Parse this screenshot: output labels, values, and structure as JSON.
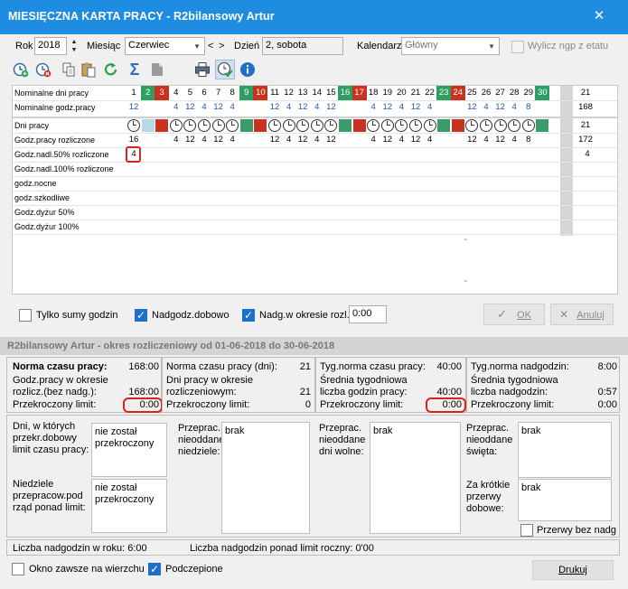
{
  "window": {
    "title": "MIESIĘCZNA KARTA PRACY - R2bilansowy Artur"
  },
  "filters": {
    "year_label": "Rok",
    "year_value": "2018",
    "month_label": "Miesiąc",
    "month_value": "Czerwiec",
    "nav_prev": "<",
    "nav_next": ">",
    "day_label": "Dzień",
    "day_value": "2, sobota",
    "calendar_label": "Kalendarz",
    "calendar_value": "Główny",
    "ngp_label": "Wylicz ngp z etatu"
  },
  "toolbar": {
    "icons": [
      "clock-add-icon",
      "clock-remove-icon",
      "copy-icon",
      "paste-icon",
      "refresh-icon",
      "sum-icon",
      "report-icon",
      "print-icon",
      "schedule-icon",
      "info-icon"
    ]
  },
  "grid": {
    "days": [
      "1",
      "2",
      "3",
      "4",
      "5",
      "6",
      "7",
      "8",
      "9",
      "10",
      "11",
      "12",
      "13",
      "14",
      "15",
      "16",
      "17",
      "18",
      "19",
      "20",
      "21",
      "22",
      "23",
      "24",
      "25",
      "26",
      "27",
      "28",
      "29",
      "30"
    ],
    "green_days": [
      2,
      9,
      16,
      23,
      30
    ],
    "red_days": [
      3,
      10,
      17,
      24
    ],
    "nominal_days_label": "Nominalne dni pracy",
    "nominal_days_total": "21",
    "nominal_hours_label": "Nominalne godz.pracy",
    "nominal_hours": [
      "12",
      "",
      "",
      "4",
      "12",
      "4",
      "12",
      "4",
      "",
      "",
      "12",
      "4",
      "12",
      "4",
      "12",
      "",
      "",
      "4",
      "12",
      "4",
      "12",
      "4",
      "",
      "",
      "12",
      "4",
      "12",
      "4",
      "8",
      ""
    ],
    "nominal_hours_total": "168",
    "workdays_label": "Dni pracy",
    "workdays_total": "21",
    "settled_label": "Godz.pracy rozliczone",
    "settled_hours": [
      "16",
      "",
      "",
      "4",
      "12",
      "4",
      "12",
      "4",
      "",
      "",
      "12",
      "4",
      "12",
      "4",
      "12",
      "",
      "",
      "4",
      "12",
      "4",
      "12",
      "4",
      "",
      "",
      "12",
      "4",
      "12",
      "4",
      "8",
      ""
    ],
    "settled_total": "172",
    "ot50_label": "Godz.nadl.50% rozliczone",
    "ot50_first": "4",
    "ot50_total": "4",
    "ot100_label": "Godz.nadl.100% rozliczone",
    "night_label": "godz.nocne",
    "harmful_label": "godz.szkodliwe",
    "duty50_label": "Godz.dyżur 50%",
    "duty100_label": "Godz.dyżur 100%"
  },
  "options": {
    "sums_only": "Tylko sumy godzin",
    "ot_daily": "Nadgodz.dobowo",
    "ot_period": "Nadg.w okresie rozl.",
    "ot_period_value": "0:00"
  },
  "buttons": {
    "ok": "OK",
    "cancel": "Anuluj",
    "print": "Drukuj"
  },
  "period": {
    "header": "R2bilansowy Artur - okres rozliczeniowy od 01-06-2018 do 30-06-2018",
    "norm_time_label": "Norma czasu pracy:",
    "norm_time_value": "168:00",
    "settled_label": "Godz.pracy w okresie rozlicz.(bez nadg.):",
    "settled_value": "168:00",
    "exceed1_label": "Przekroczony limit:",
    "exceed1_value": "0:00",
    "norm_days_label": "Norma czasu pracy (dni):",
    "norm_days_value": "21",
    "days_in_period_label": "Dni pracy w okresie rozliczeniowym:",
    "days_in_period_value": "21",
    "exceed2_label": "Przekroczony limit:",
    "exceed2_value": "0",
    "weekly_norm_label": "Tyg.norma czasu pracy:",
    "weekly_norm_value": "40:00",
    "weekly_avg_label": "Średnia tygodniowa liczba godzin pracy:",
    "weekly_avg_value": "40:00",
    "exceed3_label": "Przekroczony limit:",
    "exceed3_value": "0:00",
    "weekly_ot_label": "Tyg.norma nadgodzin:",
    "weekly_ot_value": "8:00",
    "weekly_ot_avg_label": "Średnia tygodniowa liczba nadgodzin:",
    "weekly_ot_avg_value": "0:57",
    "exceed4_label": "Przekroczony limit:",
    "exceed4_value": "0:00",
    "daily_exceed_label": "Dni, w których przekr.dobowy limit czasu pracy:",
    "daily_exceed_value": "nie został przekroczony",
    "sundays_over_label": "Niedziele przepracow.pod rząd ponad limit:",
    "sundays_over_value": "nie został przekroczony",
    "unreturned_sundays_label": "Przeprac. nieoddane niedziele:",
    "unreturned_sundays_value": "brak",
    "unreturned_free_label": "Przeprac. nieoddane dni wolne:",
    "unreturned_free_value": "brak",
    "unreturned_holidays_label": "Przeprac. nieoddane święta:",
    "unreturned_holidays_value": "brak",
    "short_breaks_label": "Za krótkie przerwy dobowe:",
    "short_breaks_value": "brak",
    "breaks_no_ot_label": "Przerwy bez nadg",
    "yearly_ot": "Liczba nadgodzin w roku: 6:00",
    "yearly_ot_over": "Liczba nadgodzin ponad limit roczny: 0'00"
  },
  "footer": {
    "always_on_top": "Okno zawsze na wierzchu",
    "docked": "Podczepione"
  }
}
